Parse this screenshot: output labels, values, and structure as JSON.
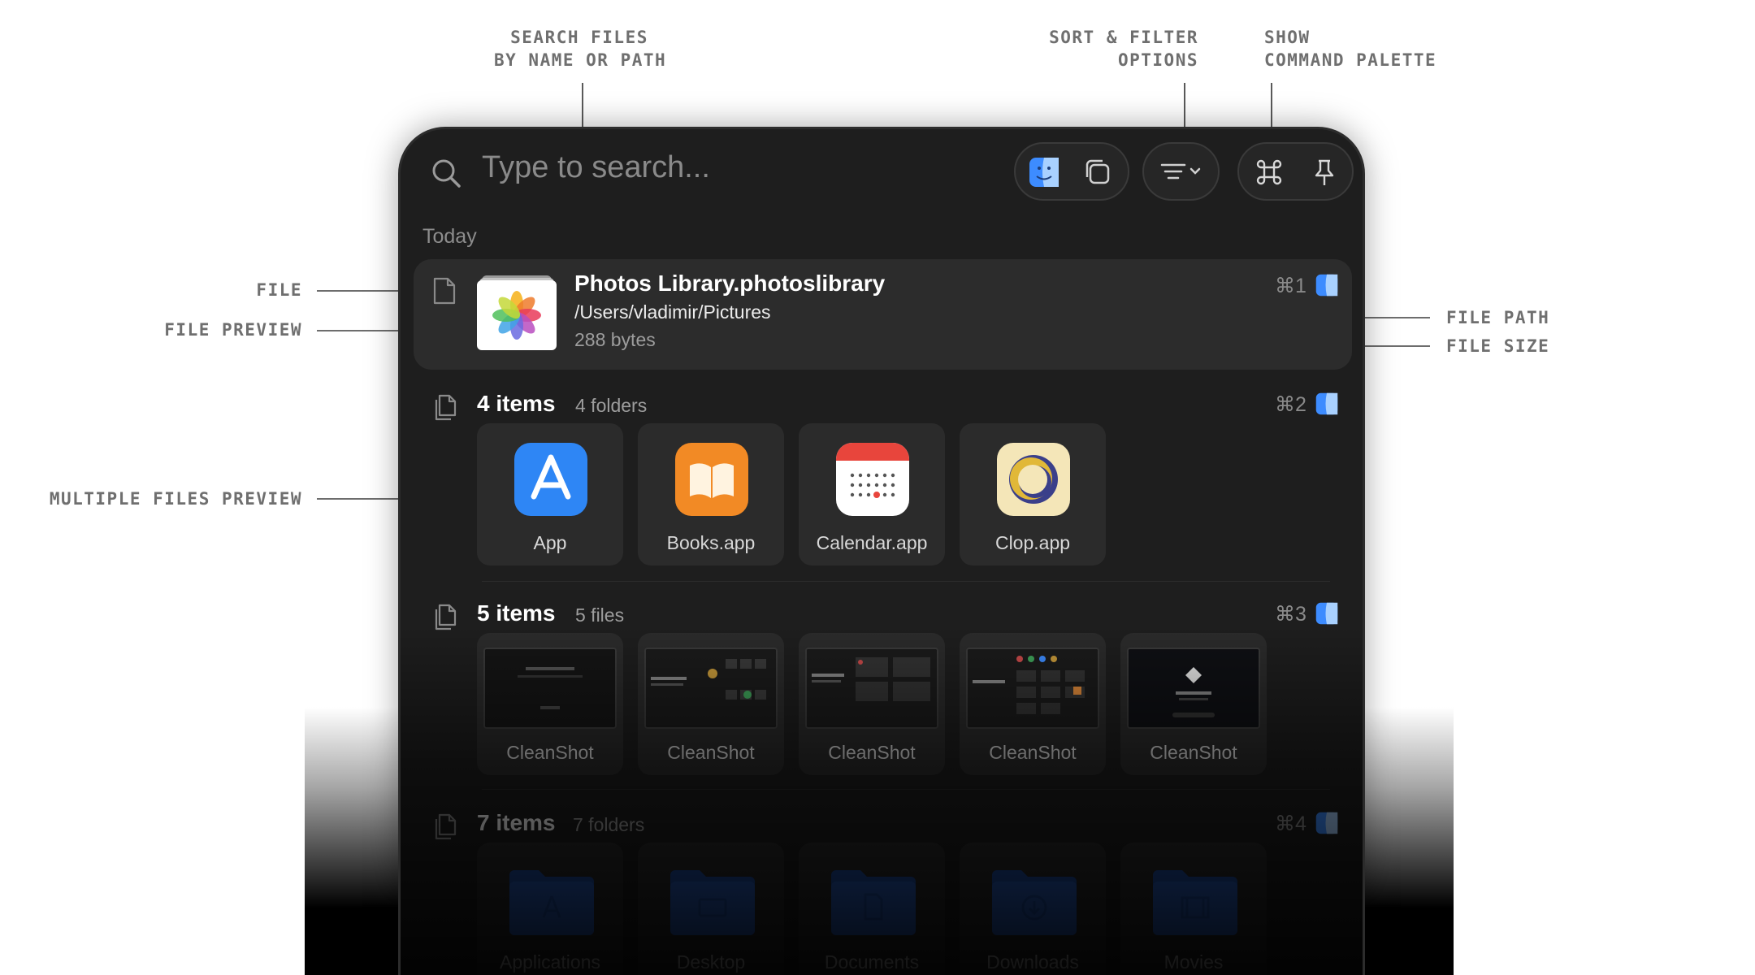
{
  "annotations": {
    "search": [
      "SEARCH FILES",
      "BY NAME OR PATH"
    ],
    "sort": [
      "SORT & FILTER",
      "OPTIONS"
    ],
    "palette": [
      "SHOW",
      "COMMAND PALETTE"
    ],
    "file": "FILE",
    "file_preview": "FILE PREVIEW",
    "multiple_files_preview": "MULTIPLE FILES PREVIEW",
    "file_path": "FILE PATH",
    "file_size": "FILE SIZE"
  },
  "search": {
    "placeholder": "Type to search..."
  },
  "toolbar": {
    "icons": [
      "finder-icon",
      "copy-icon",
      "sort-filter-icon",
      "command-icon",
      "pin-icon"
    ]
  },
  "section": {
    "label": "Today"
  },
  "file_row": {
    "name": "Photos Library.photoslibrary",
    "path": "/Users/vladimir/Pictures",
    "size": "288 bytes",
    "shortcut": "⌘1"
  },
  "groups": [
    {
      "count": "4 items",
      "detail": "4 folders",
      "shortcut": "⌘2",
      "items": [
        "App",
        "Books.app",
        "Calendar.app",
        "Clop.app"
      ]
    },
    {
      "count": "5 items",
      "detail": "5 files",
      "shortcut": "⌘3",
      "items": [
        "CleanShot",
        "CleanShot",
        "CleanShot",
        "CleanShot",
        "CleanShot"
      ]
    },
    {
      "count": "7 items",
      "detail": "7 folders",
      "shortcut": "⌘4",
      "items": [
        "Applications",
        "Desktop",
        "Documents",
        "Downloads",
        "Movies"
      ]
    }
  ],
  "colors": {
    "accent": "#3d8cff",
    "panel": "#1e1e1e",
    "card": "#2c2c2c",
    "folder": "#1e4fa8"
  }
}
